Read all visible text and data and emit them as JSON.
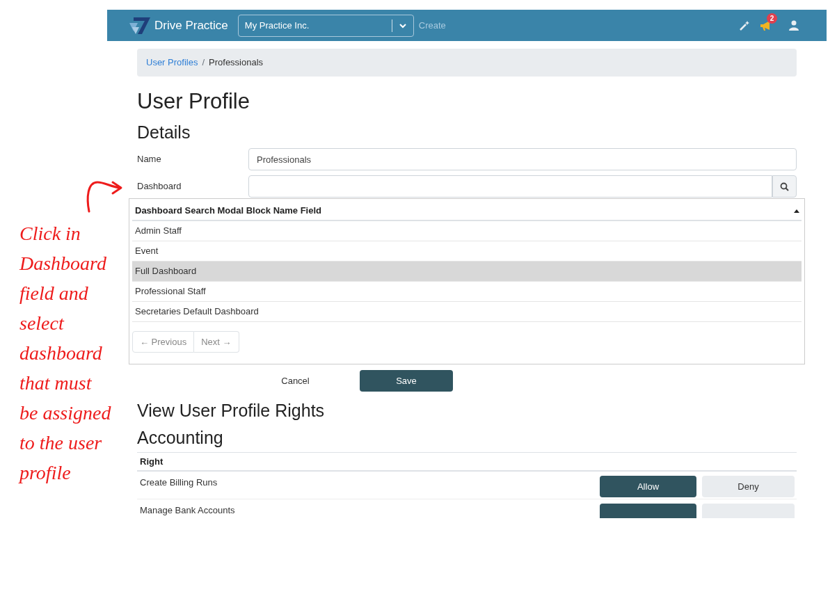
{
  "annotation": {
    "text": "Click in Dashboard field and select dashboard that must be assigned to the user profile"
  },
  "header": {
    "brand": "Drive Practice",
    "practice_select": {
      "value": "My Practice Inc."
    },
    "create_link": "Create",
    "notification_count": "2"
  },
  "breadcrumb_separator": "/",
  "breadcrumb": [
    {
      "label": "User Profiles",
      "link": true
    },
    {
      "label": "Professionals",
      "link": false
    }
  ],
  "title": "User Profile",
  "details": {
    "heading": "Details",
    "name": {
      "label": "Name",
      "value": "Professionals"
    },
    "dashboard": {
      "label": "Dashboard"
    }
  },
  "dashboard_search": {
    "column": "Dashboard Search Modal Block Name Field",
    "items": [
      {
        "label": "Admin Staff",
        "selected": false
      },
      {
        "label": "Event",
        "selected": false
      },
      {
        "label": "Full Dashboard",
        "selected": true
      },
      {
        "label": "Professional Staff",
        "selected": false
      },
      {
        "label": "Secretaries Default Dashboard",
        "selected": false
      }
    ],
    "previous": "← Previous",
    "next": "Next →"
  },
  "actions": {
    "cancel": "Cancel",
    "save": "Save"
  },
  "rights": {
    "heading": "View User Profile Rights",
    "section": "Accounting",
    "column": "Right",
    "rows": [
      {
        "label": "Create Billing Runs",
        "allowed": true,
        "allow_label": "Allow",
        "deny_label": "Deny"
      },
      {
        "label": "Manage Bank Accounts",
        "allowed": true
      }
    ]
  }
}
